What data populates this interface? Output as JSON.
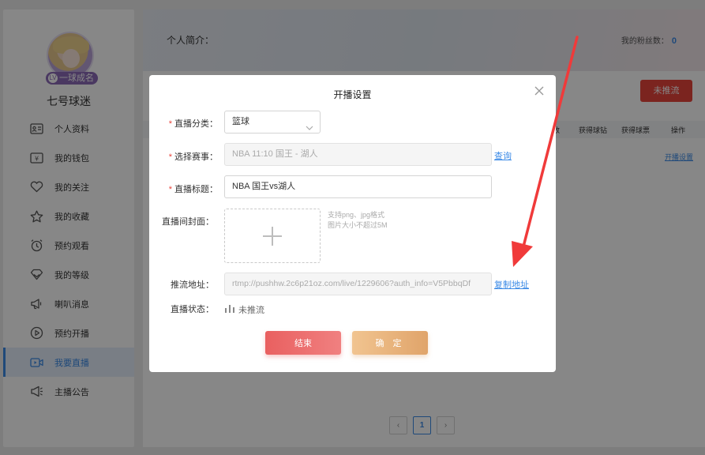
{
  "sidebar": {
    "level_badge": "一球成名",
    "level_icon": "LV",
    "username": "七号球迷",
    "items": [
      {
        "label": "个人资料",
        "icon": "id-card-icon"
      },
      {
        "label": "我的钱包",
        "icon": "wallet-icon"
      },
      {
        "label": "我的关注",
        "icon": "heart-icon"
      },
      {
        "label": "我的收藏",
        "icon": "star-icon"
      },
      {
        "label": "预约观看",
        "icon": "alarm-clock-icon"
      },
      {
        "label": "我的等级",
        "icon": "diamond-icon"
      },
      {
        "label": "喇叭消息",
        "icon": "megaphone-icon"
      },
      {
        "label": "预约开播",
        "icon": "play-circle-icon"
      },
      {
        "label": "我要直播",
        "icon": "video-icon",
        "active": true
      },
      {
        "label": "主播公告",
        "icon": "announcement-icon"
      }
    ]
  },
  "profile": {
    "intro_label": "个人简介：",
    "fans_label": "我的粉丝数：",
    "fans_count": "0"
  },
  "live_button": "未推流",
  "table": {
    "headers": [
      "数",
      "获得球钻",
      "获得球票",
      "操作"
    ],
    "row_action": "开播设置"
  },
  "pagination": {
    "current": "1",
    "prev": "‹",
    "next": "›"
  },
  "modal": {
    "title": "开播设置",
    "category_label": "直播分类：",
    "category_value": "篮球",
    "match_label": "选择赛事：",
    "match_value": "NBA 11:10 国王 - 湖人",
    "match_link": "查询",
    "title_label": "直播标题：",
    "title_value": "NBA 国王vs湖人",
    "cover_label": "直播间封面：",
    "cover_hint_1": "支持png、jpg格式",
    "cover_hint_2": "图片大小不超过5M",
    "push_label": "推流地址：",
    "push_value": "rtmp://pushhw.2c6p21oz.com/live/1229606?auth_info=V5PbbqDf",
    "push_link": "复制地址",
    "status_label": "直播状态：",
    "status_value": "未推流",
    "end_button": "结束",
    "confirm_button": "确 定"
  },
  "colors": {
    "accent": "#3b8ae6",
    "danger": "#e8453c",
    "annotation_arrow": "#f03a3a"
  }
}
